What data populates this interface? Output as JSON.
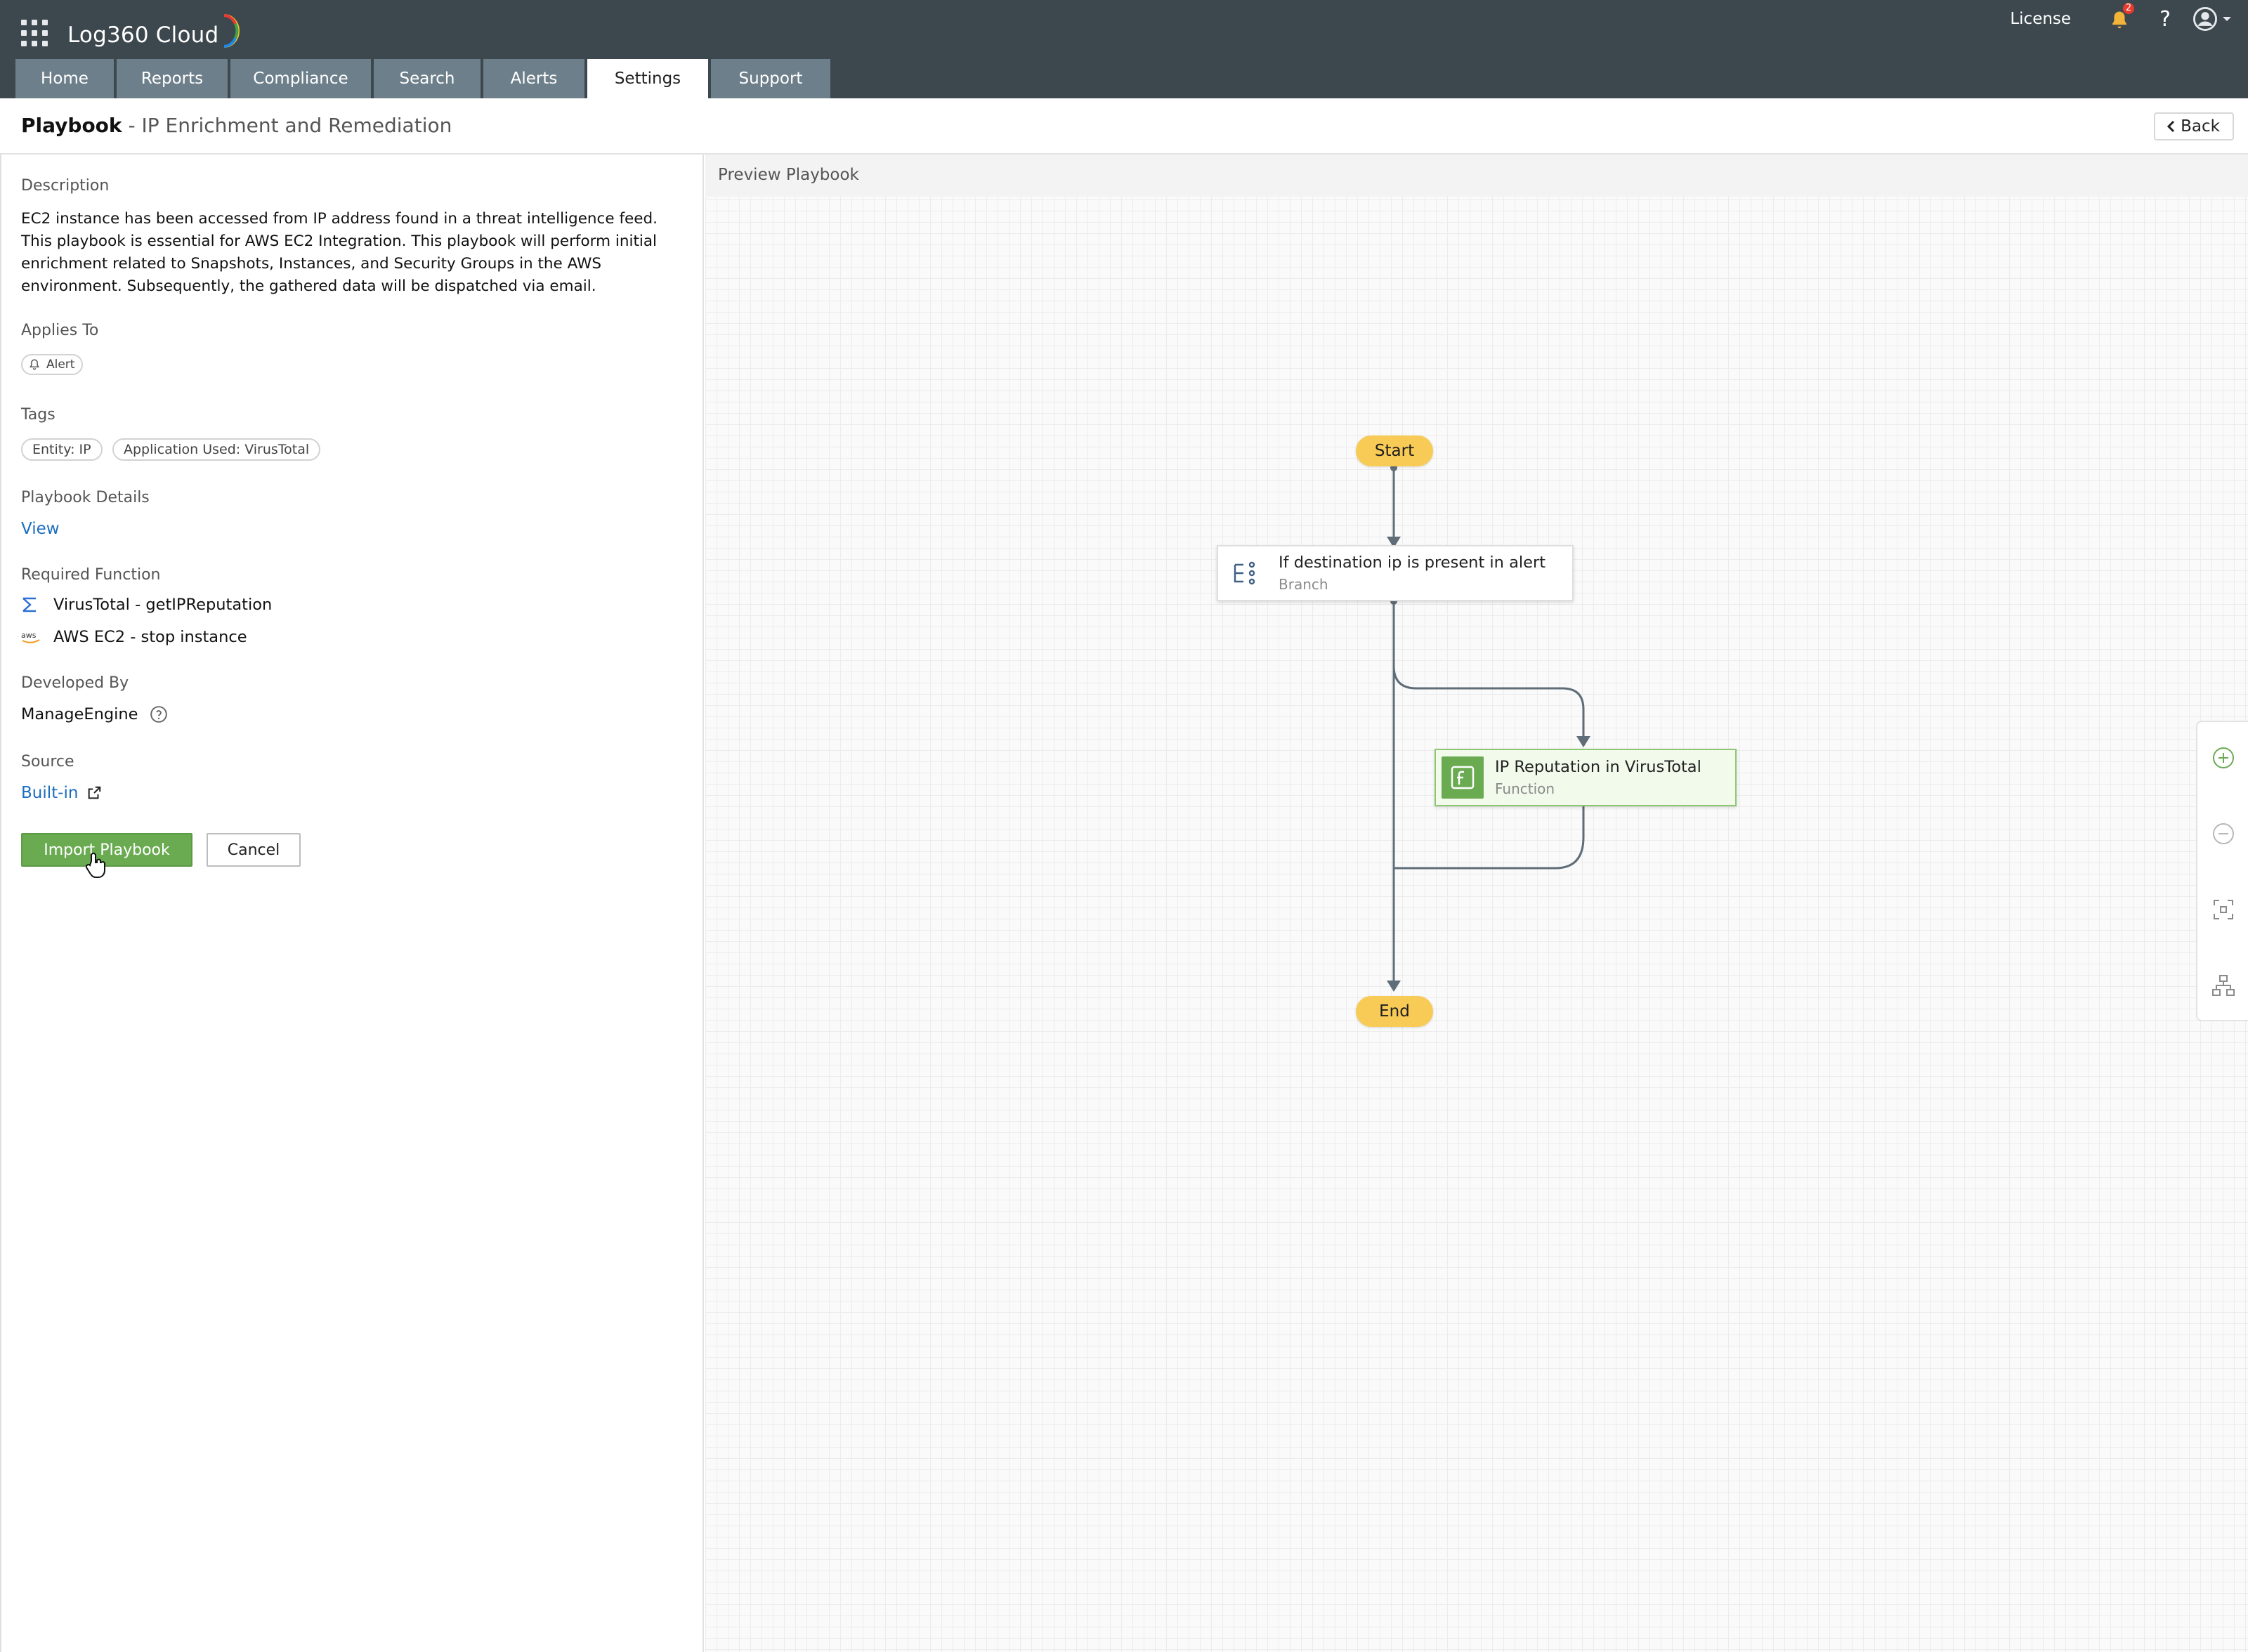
{
  "app": {
    "name": "Log360 Cloud"
  },
  "topbar": {
    "license_label": "License",
    "notification_count": "2",
    "help_label": "?"
  },
  "tabs": [
    {
      "label": "Home"
    },
    {
      "label": "Reports"
    },
    {
      "label": "Compliance"
    },
    {
      "label": "Search"
    },
    {
      "label": "Alerts"
    },
    {
      "label": "Settings",
      "active": true
    },
    {
      "label": "Support"
    }
  ],
  "page": {
    "title": "Playbook",
    "subtitle": "- IP Enrichment and Remediation",
    "back_label": "Back"
  },
  "details": {
    "description_label": "Description",
    "description": "EC2 instance has been accessed from IP address found in a threat intelligence feed. This playbook is essential for AWS EC2 Integration. This playbook will perform initial enrichment related to Snapshots, Instances, and Security Groups in the AWS environment. Subsequently, the gathered data will be dispatched via email.",
    "applies_to_label": "Applies To",
    "applies_to": "Alert",
    "tags_label": "Tags",
    "tags": [
      "Entity: IP",
      "Application Used: VirusTotal"
    ],
    "playbook_details_label": "Playbook Details",
    "view_link": "View",
    "required_function_label": "Required Function",
    "functions": [
      {
        "icon": "virustotal-icon",
        "label": "VirusTotal - getIPReputation"
      },
      {
        "icon": "aws-icon",
        "label": "AWS EC2 - stop instance"
      }
    ],
    "developed_by_label": "Developed By",
    "developed_by": "ManageEngine",
    "source_label": "Source",
    "source": "Built-in",
    "import_button": "Import Playbook",
    "cancel_button": "Cancel"
  },
  "preview": {
    "title": "Preview Playbook",
    "start_label": "Start",
    "end_label": "End",
    "nodes": [
      {
        "title": "If destination ip is present in alert",
        "type": "Branch"
      },
      {
        "title": "IP Reputation in VirusTotal",
        "type": "Function"
      }
    ]
  },
  "colors": {
    "topbar": "#3d474e",
    "tab": "#6d7f8a",
    "accent_green": "#6aab52",
    "terminal_yellow": "#f8cb57",
    "link_blue": "#1c6dbf"
  }
}
